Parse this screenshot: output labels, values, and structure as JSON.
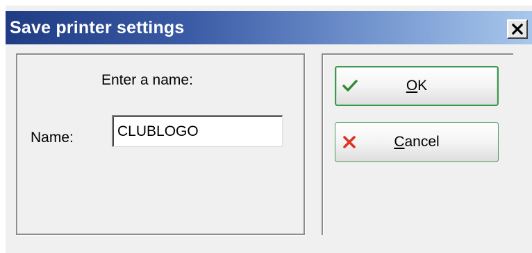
{
  "window": {
    "title": "Save printer settings",
    "close_glyph": "×"
  },
  "form": {
    "prompt": "Enter a name:",
    "name_label": "Name:",
    "name_value": "CLUBLOGO"
  },
  "buttons": {
    "ok": {
      "mnemonic": "O",
      "rest": "K",
      "icon": "checkmark-icon",
      "color": "#2e8b2e"
    },
    "cancel": {
      "mnemonic": "C",
      "rest": "ancel",
      "icon": "x-mark-icon",
      "color": "#e03020"
    }
  },
  "colors": {
    "titlebar_start": "#1f3c84",
    "titlebar_end": "#a9c7ec",
    "dialog_bg": "#f0f0f0",
    "button_border": "#3f9550"
  }
}
